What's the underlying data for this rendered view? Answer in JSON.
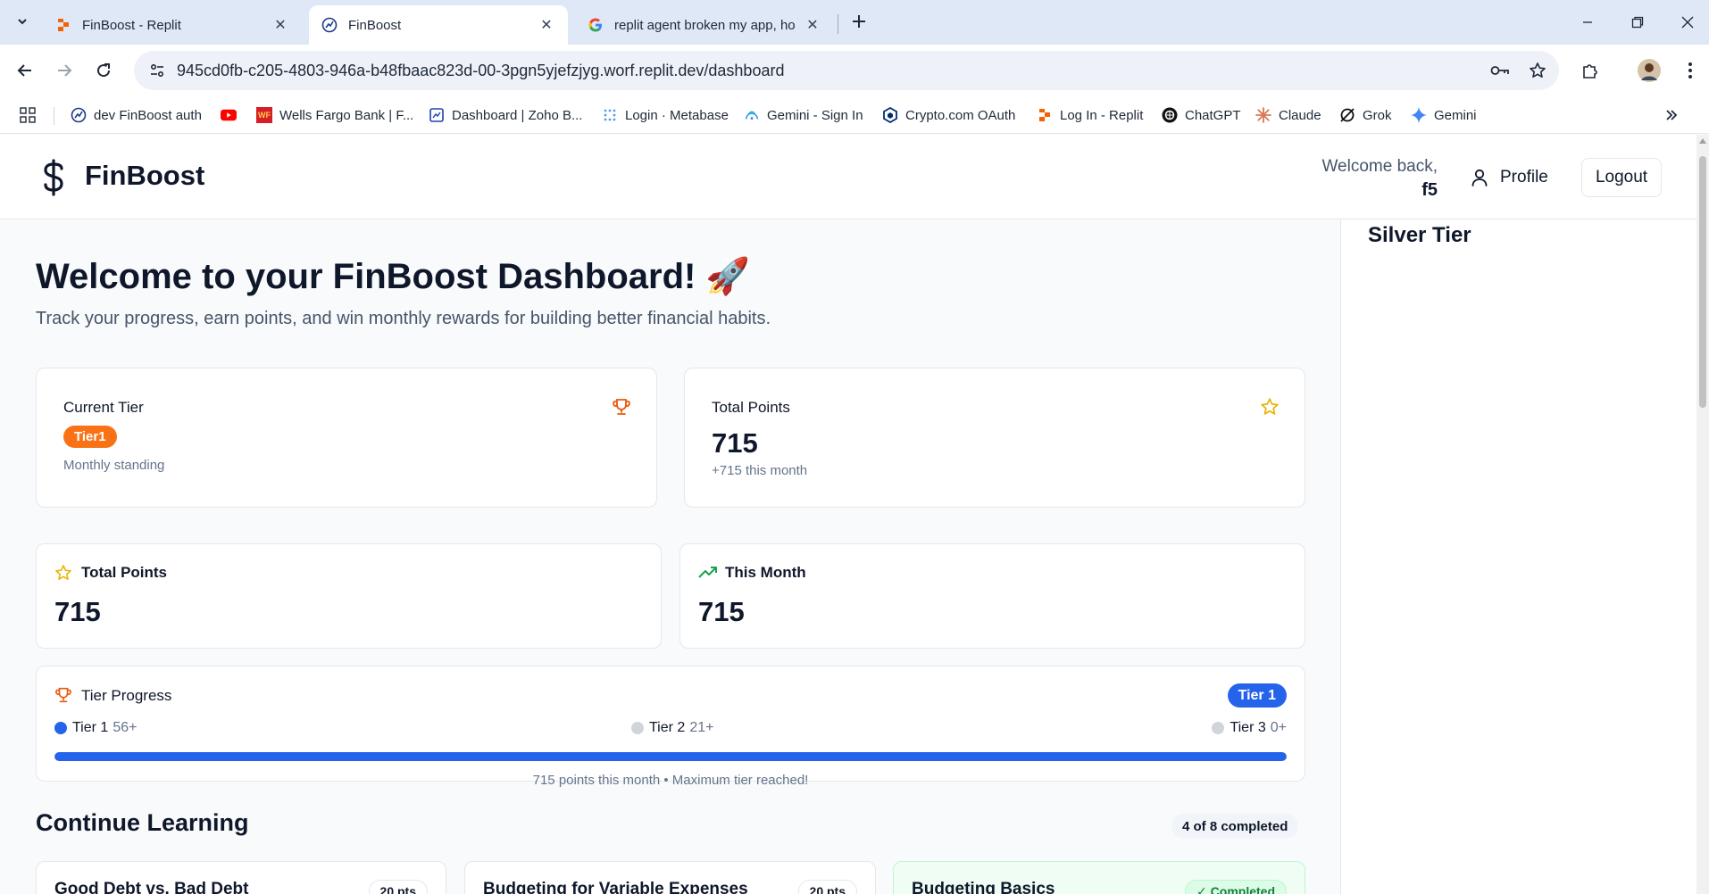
{
  "browser": {
    "tabs": [
      {
        "title": "FinBoost - Replit",
        "favicon": "replit-icon"
      },
      {
        "title": "FinBoost",
        "favicon": "finboost-icon"
      },
      {
        "title": "replit agent broken my app, ho",
        "favicon": "google-icon"
      }
    ],
    "url": "945cd0fb-c205-4803-946a-b48fbaac823d-00-3pgn5yjefzjyg.worf.replit.dev/dashboard",
    "bookmarks": [
      {
        "label": "dev FinBoost auth",
        "icon": "finboost-icon"
      },
      {
        "label": "",
        "icon": "youtube-icon"
      },
      {
        "label": "Wells Fargo Bank | F...",
        "icon": "wells-fargo-icon"
      },
      {
        "label": "Dashboard | Zoho B...",
        "icon": "zoho-icon"
      },
      {
        "label": "Login · Metabase",
        "icon": "metabase-icon"
      },
      {
        "label": "Gemini - Sign In",
        "icon": "gemini-signin-icon"
      },
      {
        "label": "Crypto.com OAuth",
        "icon": "crypto-icon"
      },
      {
        "label": "Log In - Replit",
        "icon": "replit-icon"
      },
      {
        "label": "ChatGPT",
        "icon": "chatgpt-icon"
      },
      {
        "label": "Claude",
        "icon": "claude-icon"
      },
      {
        "label": "Grok",
        "icon": "grok-icon"
      },
      {
        "label": "Gemini",
        "icon": "gemini-icon"
      }
    ]
  },
  "header": {
    "logo_text": "FinBoost",
    "welcome_text": "Welcome back,",
    "username": "f5",
    "profile_label": "Profile",
    "logout_label": "Logout"
  },
  "sidebar": {
    "tier_title": "Silver Tier"
  },
  "main": {
    "title": "Welcome to your FinBoost Dashboard! 🚀",
    "subtitle": "Track your progress, earn points, and win monthly rewards for building better financial habits.",
    "current_tier_card": {
      "label": "Current Tier",
      "tier": "Tier1",
      "note": "Monthly standing"
    },
    "total_points_card": {
      "label": "Total Points",
      "value": "715",
      "note": "+715 this month"
    },
    "stat_total": {
      "label": "Total Points",
      "value": "715"
    },
    "stat_month": {
      "label": "This Month",
      "value": "715"
    },
    "tier_progress": {
      "label": "Tier Progress",
      "badge": "Tier 1",
      "tiers": [
        {
          "name": "Tier 1",
          "min": "56+",
          "active": true
        },
        {
          "name": "Tier 2",
          "min": "21+",
          "active": false
        },
        {
          "name": "Tier 3",
          "min": "0+",
          "active": false
        }
      ],
      "progress_fraction": 1.0,
      "footer": "715 points this month • Maximum tier reached!"
    },
    "learning": {
      "title": "Continue Learning",
      "completed_badge": "4 of 8 completed",
      "lessons": [
        {
          "title": "Good Debt vs. Bad Debt",
          "badge": "20 pts",
          "completed": false
        },
        {
          "title": "Budgeting for Variable Expenses",
          "badge": "20 pts",
          "completed": false
        },
        {
          "title": "Budgeting Basics",
          "badge": "✓ Completed",
          "completed": true
        }
      ]
    }
  },
  "colors": {
    "accent_blue": "#2563eb",
    "tier_orange": "#f97316",
    "star_yellow": "#eab308",
    "trend_green": "#16a34a"
  }
}
